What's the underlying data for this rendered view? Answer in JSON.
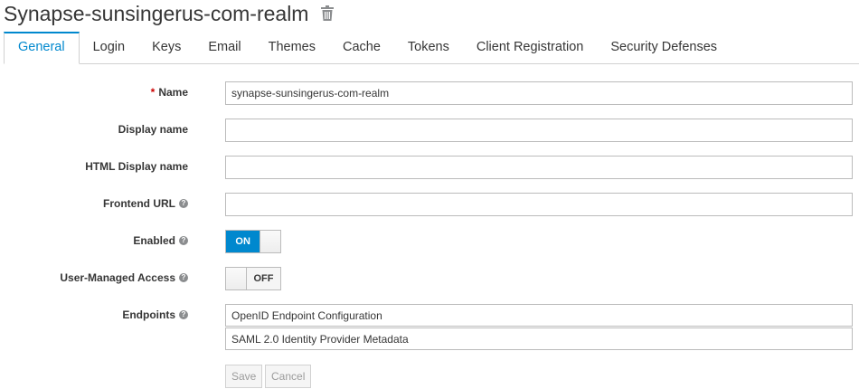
{
  "header": {
    "title": "Synapse-sunsingerus-com-realm"
  },
  "tabs": [
    {
      "label": "General",
      "active": true
    },
    {
      "label": "Login"
    },
    {
      "label": "Keys"
    },
    {
      "label": "Email"
    },
    {
      "label": "Themes"
    },
    {
      "label": "Cache"
    },
    {
      "label": "Tokens"
    },
    {
      "label": "Client Registration"
    },
    {
      "label": "Security Defenses"
    }
  ],
  "form": {
    "name_label": "Name",
    "name_required_mark": "*",
    "name_value": "synapse-sunsingerus-com-realm",
    "display_name_label": "Display name",
    "display_name_value": "",
    "html_display_name_label": "HTML Display name",
    "html_display_name_value": "",
    "frontend_url_label": "Frontend URL",
    "frontend_url_value": "",
    "enabled_label": "Enabled",
    "enabled_state": "ON",
    "user_managed_access_label": "User-Managed Access",
    "user_managed_access_state": "OFF",
    "endpoints_label": "Endpoints",
    "endpoints": [
      "OpenID Endpoint Configuration",
      "SAML 2.0 Identity Provider Metadata"
    ],
    "save_label": "Save",
    "cancel_label": "Cancel"
  },
  "icons": {
    "help": "question-circle-icon",
    "delete": "trash-icon"
  },
  "colors": {
    "accent": "#0088ce",
    "required": "#cc0000",
    "text": "#363636"
  }
}
